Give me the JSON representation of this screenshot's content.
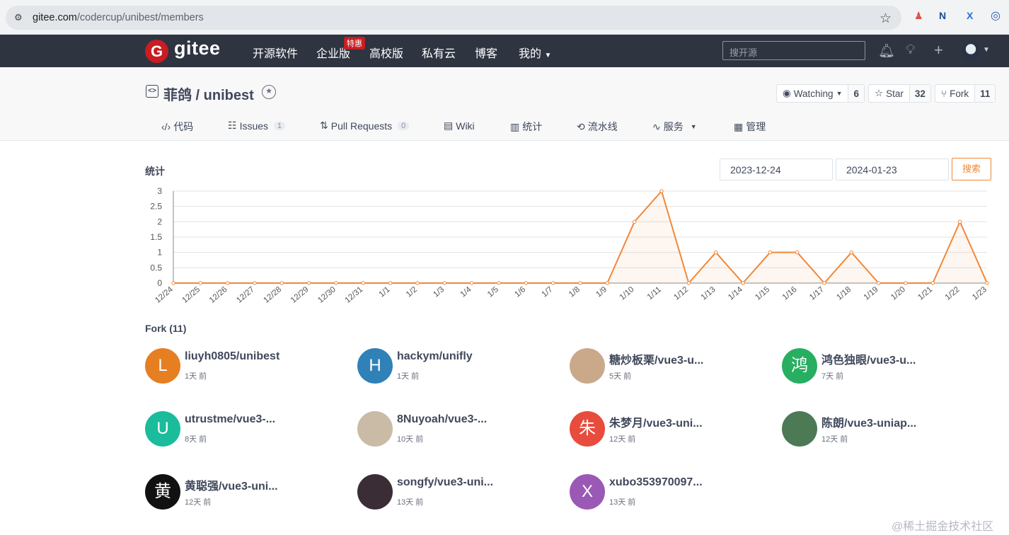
{
  "browser": {
    "url_host": "gitee.com",
    "url_path": "/codercup/unibest/members"
  },
  "header": {
    "logo_letter": "G",
    "logo_text": "gitee",
    "nav": [
      "开源软件",
      "企业版",
      "高校版",
      "私有云",
      "博客",
      "我的"
    ],
    "hot_badge": "特惠",
    "search_placeholder": "搜开源"
  },
  "repo": {
    "title": "菲鸽 / unibest",
    "watching_label": "Watching",
    "watching_count": "6",
    "star_label": "Star",
    "star_count": "32",
    "fork_label": "Fork",
    "fork_count": "11",
    "tabs": [
      {
        "label": "代码",
        "icon": "code-icon"
      },
      {
        "label": "Issues",
        "count": "1",
        "icon": "issues-icon"
      },
      {
        "label": "Pull Requests",
        "count": "0",
        "icon": "pull-request-icon"
      },
      {
        "label": "Wiki",
        "icon": "wiki-icon"
      },
      {
        "label": "统计",
        "icon": "stats-icon"
      },
      {
        "label": "流水线",
        "icon": "pipeline-icon"
      },
      {
        "label": "服务",
        "icon": "service-icon"
      },
      {
        "label": "管理",
        "icon": "manage-icon"
      }
    ]
  },
  "stats": {
    "title": "统计",
    "start_date": "2023-12-24",
    "end_date": "2024-01-23",
    "search_label": "搜索"
  },
  "chart_data": {
    "type": "area",
    "categories": [
      "12/24",
      "12/25",
      "12/26",
      "12/27",
      "12/28",
      "12/29",
      "12/30",
      "12/31",
      "1/1",
      "1/2",
      "1/3",
      "1/4",
      "1/5",
      "1/6",
      "1/7",
      "1/8",
      "1/9",
      "1/10",
      "1/11",
      "1/12",
      "1/13",
      "1/14",
      "1/15",
      "1/16",
      "1/17",
      "1/18",
      "1/19",
      "1/20",
      "1/21",
      "1/22",
      "1/23"
    ],
    "values": [
      0,
      0,
      0,
      0,
      0,
      0,
      0,
      0,
      0,
      0,
      0,
      0,
      0,
      0,
      0,
      0,
      0,
      2,
      3,
      0,
      1,
      0,
      1,
      1,
      0,
      1,
      0,
      0,
      0,
      2,
      0
    ],
    "yticks": [
      "0",
      "0.5",
      "1",
      "1.5",
      "2",
      "2.5",
      "3"
    ],
    "ylim": [
      0,
      3
    ],
    "grid": true,
    "color": "#f0883a"
  },
  "forks": {
    "title": "Fork (11)",
    "items": [
      {
        "name": "liuyh0805/unibest",
        "time": "1天 前",
        "letter": "L",
        "color": "#e67e22"
      },
      {
        "name": "hackym/unifly",
        "time": "1天 前",
        "letter": "H",
        "color": "#2f81b7"
      },
      {
        "name": "糖炒板栗/vue3-u...",
        "time": "5天 前",
        "letter": "",
        "color": "#caa98a"
      },
      {
        "name": "鸿色独眼/vue3-u...",
        "time": "7天 前",
        "letter": "鸿",
        "color": "#27ae60"
      },
      {
        "name": "utrustme/vue3-...",
        "time": "8天 前",
        "letter": "U",
        "color": "#1abc9c"
      },
      {
        "name": "8Nuyoah/vue3-...",
        "time": "10天 前",
        "letter": "",
        "color": "#c9bba5"
      },
      {
        "name": "朱梦月/vue3-uni...",
        "time": "12天 前",
        "letter": "朱",
        "color": "#e74c3c"
      },
      {
        "name": "陈朗/vue3-uniap...",
        "time": "12天 前",
        "letter": "",
        "color": "#4c7a55"
      },
      {
        "name": "黄聪强/vue3-uni...",
        "time": "12天 前",
        "letter": "黄",
        "color": "#111111"
      },
      {
        "name": "songfy/vue3-uni...",
        "time": "13天 前",
        "letter": "",
        "color": "#3a2d35"
      },
      {
        "name": "xubo353970097...",
        "time": "13天 前",
        "letter": "X",
        "color": "#9b59b6"
      }
    ]
  },
  "watermark": "@稀土掘金技术社区"
}
